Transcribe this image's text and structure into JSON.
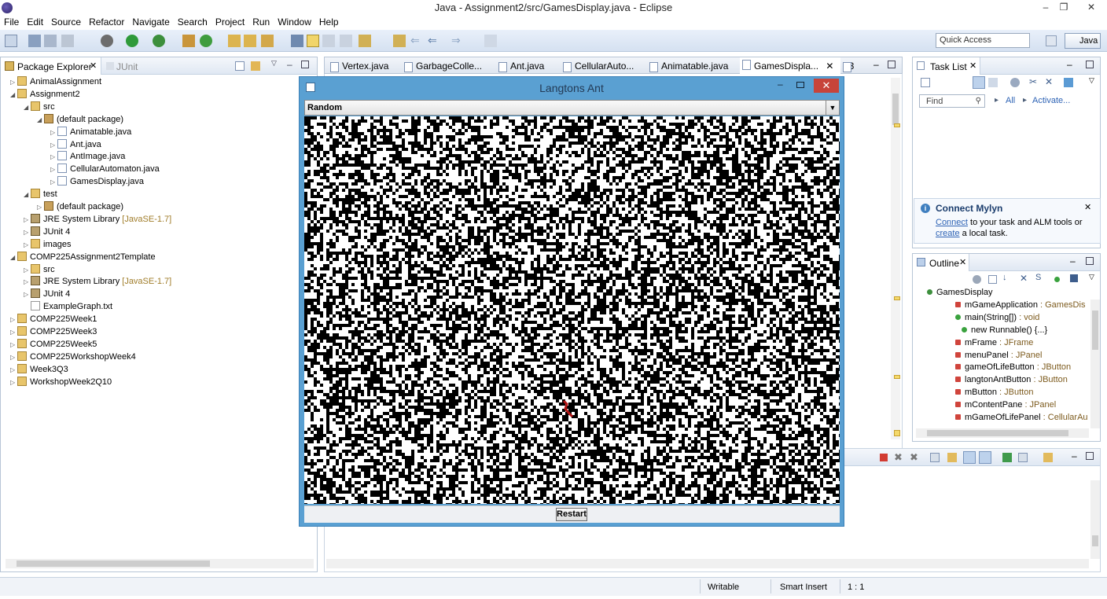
{
  "window": {
    "title": "Java - Assignment2/src/GamesDisplay.java - Eclipse"
  },
  "menu": [
    "File",
    "Edit",
    "Source",
    "Refactor",
    "Navigate",
    "Search",
    "Project",
    "Run",
    "Window",
    "Help"
  ],
  "quick_access": {
    "placeholder": "Quick Access"
  },
  "perspective": {
    "label": "Java"
  },
  "package_explorer": {
    "tab_label": "Package Explorer",
    "junit_tab_label": "JUnit",
    "tree": [
      {
        "depth": 0,
        "twisty": "▷",
        "icon": "project",
        "label": "AnimalAssignment"
      },
      {
        "depth": 0,
        "twisty": "◢",
        "icon": "project",
        "label": "Assignment2"
      },
      {
        "depth": 1,
        "twisty": "◢",
        "icon": "folder",
        "label": "src"
      },
      {
        "depth": 2,
        "twisty": "◢",
        "icon": "package",
        "label": "(default package)"
      },
      {
        "depth": 3,
        "twisty": "▷",
        "icon": "java",
        "label": "Animatable.java"
      },
      {
        "depth": 3,
        "twisty": "▷",
        "icon": "java",
        "label": "Ant.java"
      },
      {
        "depth": 3,
        "twisty": "▷",
        "icon": "java",
        "label": "AntImage.java"
      },
      {
        "depth": 3,
        "twisty": "▷",
        "icon": "java",
        "label": "CellularAutomaton.java"
      },
      {
        "depth": 3,
        "twisty": "▷",
        "icon": "java",
        "label": "GamesDisplay.java"
      },
      {
        "depth": 1,
        "twisty": "◢",
        "icon": "folder",
        "label": "test"
      },
      {
        "depth": 2,
        "twisty": "▷",
        "icon": "package",
        "label": "(default package)"
      },
      {
        "depth": 1,
        "twisty": "▷",
        "icon": "library",
        "label": "JRE System Library",
        "decoration": " [JavaSE-1.7]"
      },
      {
        "depth": 1,
        "twisty": "▷",
        "icon": "library",
        "label": "JUnit 4"
      },
      {
        "depth": 1,
        "twisty": "▷",
        "icon": "folder",
        "label": "images"
      },
      {
        "depth": 0,
        "twisty": "◢",
        "icon": "project",
        "label": "COMP225Assignment2Template"
      },
      {
        "depth": 1,
        "twisty": "▷",
        "icon": "folder",
        "label": "src"
      },
      {
        "depth": 1,
        "twisty": "▷",
        "icon": "library",
        "label": "JRE System Library",
        "decoration": " [JavaSE-1.7]"
      },
      {
        "depth": 1,
        "twisty": "▷",
        "icon": "library",
        "label": "JUnit 4"
      },
      {
        "depth": 1,
        "twisty": "",
        "icon": "file",
        "label": "ExampleGraph.txt"
      },
      {
        "depth": 0,
        "twisty": "▷",
        "icon": "project",
        "label": "COMP225Week1"
      },
      {
        "depth": 0,
        "twisty": "▷",
        "icon": "project",
        "label": "COMP225Week3"
      },
      {
        "depth": 0,
        "twisty": "▷",
        "icon": "project",
        "label": "COMP225Week5"
      },
      {
        "depth": 0,
        "twisty": "▷",
        "icon": "project",
        "label": "COMP225WorkshopWeek4"
      },
      {
        "depth": 0,
        "twisty": "▷",
        "icon": "project",
        "label": "Week3Q3"
      },
      {
        "depth": 0,
        "twisty": "▷",
        "icon": "project",
        "label": "WorkshopWeek2Q10"
      }
    ]
  },
  "editor_tabs": [
    "Vertex.java",
    "GarbageColle...",
    "Ant.java",
    "CellularAuto...",
    "Animatable.java",
    "GamesDispla..."
  ],
  "editor_overflow": "»3",
  "dialog": {
    "title": "Langtons Ant",
    "combo_value": "Random",
    "restart_label": "Restart",
    "close_glyph": "✕"
  },
  "task_list": {
    "tab_label": "Task List",
    "find_placeholder": "Find",
    "all_label": "All",
    "activate_label": "Activate..."
  },
  "mylyn": {
    "title": "Connect Mylyn",
    "connect_link": "Connect",
    "line1_rest": " to your task and ALM tools or",
    "create_link": "create",
    "line2_rest": " a local task."
  },
  "outline": {
    "tab_label": "Outline",
    "items": [
      {
        "depth": 0,
        "label": "GamesDisplay",
        "type": ""
      },
      {
        "depth": 1,
        "label": "mGameApplication",
        "type": " : GamesDis"
      },
      {
        "depth": 1,
        "label": "main(String[])",
        "type": " : void"
      },
      {
        "depth": 2,
        "label": "new Runnable() {...}",
        "type": ""
      },
      {
        "depth": 1,
        "label": "mFrame",
        "type": " : JFrame"
      },
      {
        "depth": 1,
        "label": "menuPanel",
        "type": " : JPanel"
      },
      {
        "depth": 1,
        "label": "gameOfLifeButton",
        "type": " : JButton"
      },
      {
        "depth": 1,
        "label": "langtonAntButton",
        "type": " : JButton"
      },
      {
        "depth": 1,
        "label": "mButton",
        "type": " : JButton"
      },
      {
        "depth": 1,
        "label": "mContentPane",
        "type": " : JPanel"
      },
      {
        "depth": 1,
        "label": "mGameOfLifePanel",
        "type": " : CellularAu"
      }
    ]
  },
  "status": {
    "writable": "Writable",
    "insert_mode": "Smart Insert",
    "position": "1 : 1"
  }
}
